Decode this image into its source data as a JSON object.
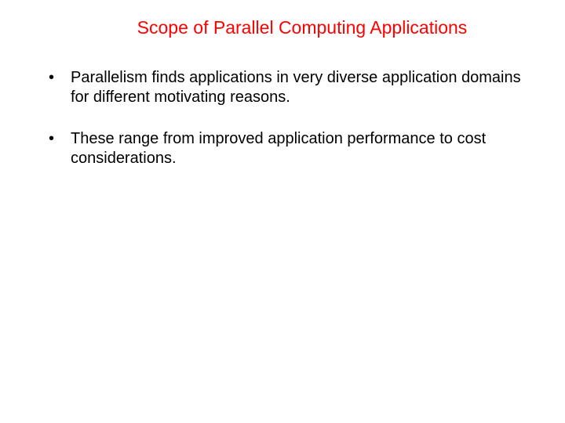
{
  "slide": {
    "title": "Scope of Parallel Computing Applications",
    "bullets": [
      "Parallelism finds applications in very diverse application domains for different motivating reasons.",
      "These range from improved application performance to cost considerations."
    ]
  }
}
